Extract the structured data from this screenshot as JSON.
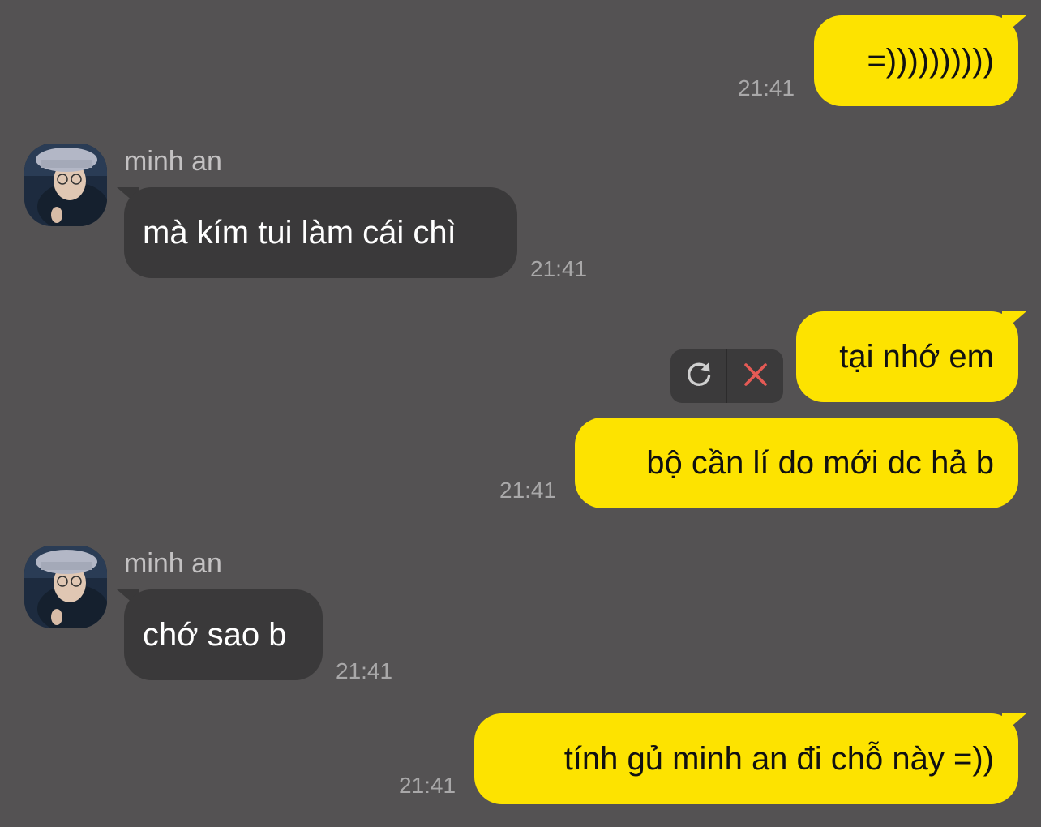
{
  "colors": {
    "background": "#545253",
    "outgoing_bubble": "#fde300",
    "incoming_bubble": "#3a393a",
    "timestamp": "#a9a8a9",
    "delete_icon": "#e55a55"
  },
  "messages": [
    {
      "direction": "outgoing",
      "text": "=))))))))))",
      "time": "21:41"
    },
    {
      "direction": "incoming",
      "sender": "minh an",
      "text": "mà kím tui làm cái chì",
      "time": "21:41"
    },
    {
      "direction": "outgoing",
      "text": "tại nhớ em",
      "status": "failed",
      "actions": [
        "refresh-icon",
        "close-icon"
      ]
    },
    {
      "direction": "outgoing",
      "text": "bộ cần lí do mới dc hả b",
      "time": "21:41"
    },
    {
      "direction": "incoming",
      "sender": "minh an",
      "text": "chớ sao b",
      "time": "21:41"
    },
    {
      "direction": "outgoing",
      "text": "tính gủ minh an đi chỗ này =))",
      "time": "21:41"
    }
  ]
}
